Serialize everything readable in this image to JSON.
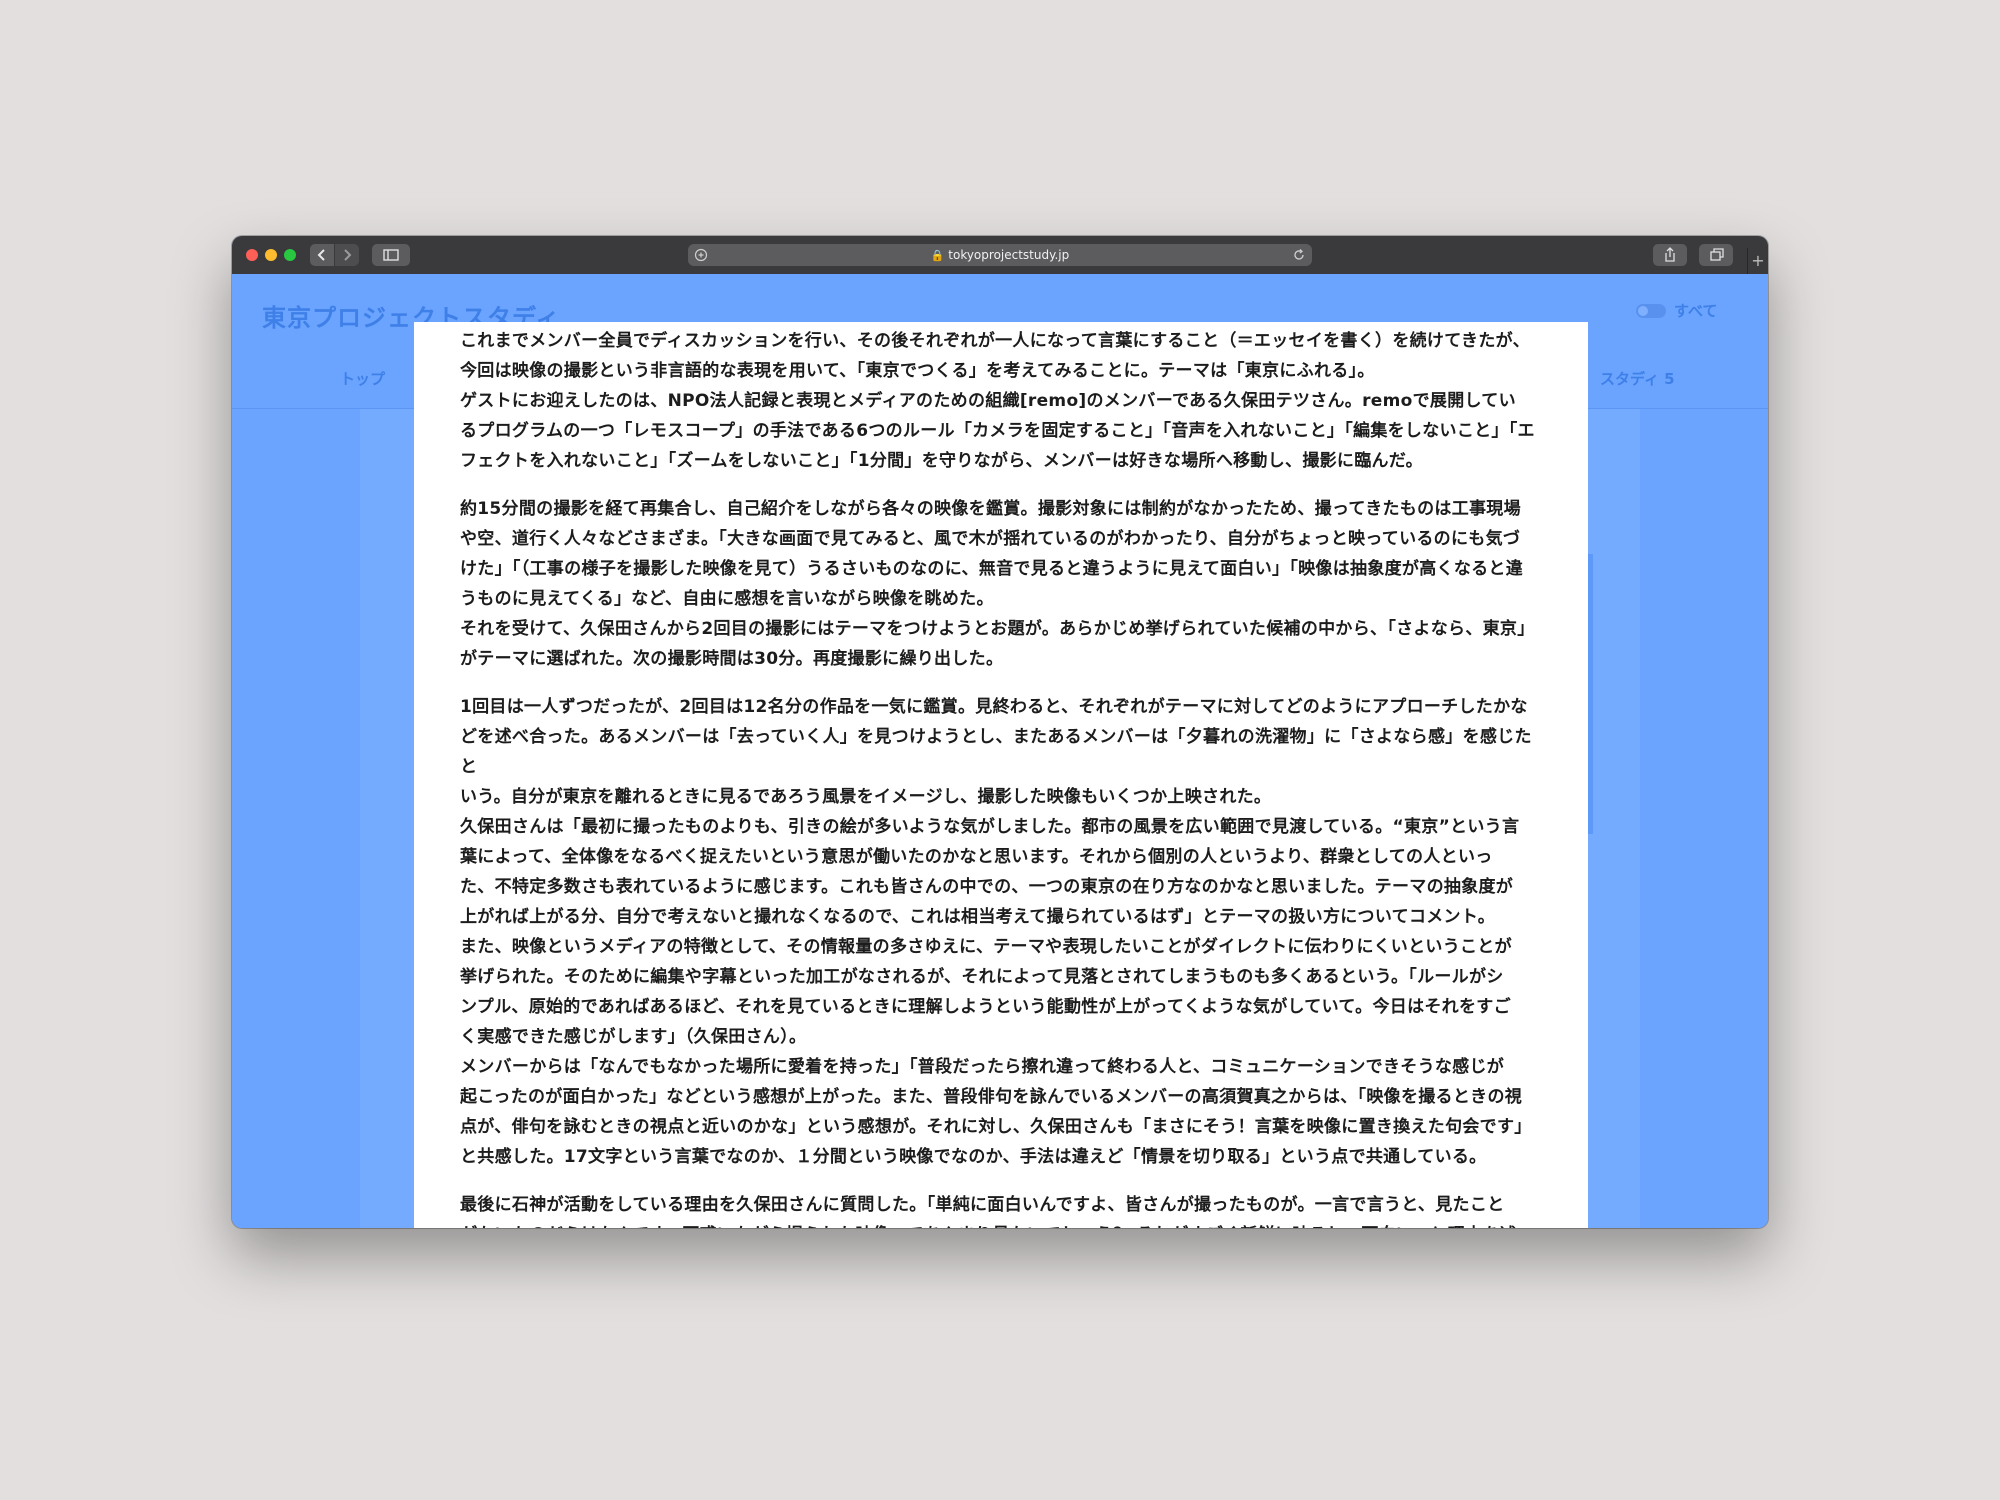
{
  "browser": {
    "url": "tokyoprojectstudy.jp",
    "new_tab_symbol": "+"
  },
  "site": {
    "title": "東京プロジェクトスタディ",
    "nav_top": "トップ",
    "nav_study": "スタディ 5",
    "filter_label": "すべて"
  },
  "article": {
    "paragraphs": [
      "これまでメンバー全員でディスカッションを行い、その後それぞれが一人になって言葉にすること（＝エッセイを書く）を続けてきたが、\n今回は映像の撮影という非言語的な表現を用いて、「東京でつくる」を考えてみることに。テーマは「東京にふれる」。\nゲストにお迎えしたのは、NPO法人記録と表現とメディアのための組織[remo]のメンバーである久保田テツさん。remoで展開してい\nるプログラムの一つ「レモスコープ」の手法である6つのルール「カメラを固定すること」「音声を入れないこと」「編集をしないこと」「エ\nフェクトを入れないこと」「ズームをしないこと」「1分間」を守りながら、メンバーは好きな場所へ移動し、撮影に臨んだ。",
      "約15分間の撮影を経て再集合し、自己紹介をしながら各々の映像を鑑賞。撮影対象には制約がなかったため、撮ってきたものは工事現場\nや空、道行く人々などさまざま。「大きな画面で見てみると、風で木が揺れているのがわかったり、自分がちょっと映っているのにも気づ\nけた」「（工事の様子を撮影した映像を見て）うるさいものなのに、無音で見ると違うように見えて面白い」「映像は抽象度が高くなると違\nうものに見えてくる」など、自由に感想を言いながら映像を眺めた。\nそれを受けて、久保田さんから2回目の撮影にはテーマをつけようとお題が。あらかじめ挙げられていた候補の中から、「さよなら、東京」\nがテーマに選ばれた。次の撮影時間は30分。再度撮影に繰り出した。",
      "1回目は一人ずつだったが、2回目は12名分の作品を一気に鑑賞。見終わると、それぞれがテーマに対してどのようにアプローチしたかな\nどを述べ合った。あるメンバーは「去っていく人」を見つけようとし、またあるメンバーは「夕暮れの洗濯物」に「さよなら感」を感じたと\nいう。自分が東京を離れるときに見るであろう風景をイメージし、撮影した映像もいくつか上映された。\n久保田さんは「最初に撮ったものよりも、引きの絵が多いような気がしました。都市の風景を広い範囲で見渡している。“東京”という言\n葉によって、全体像をなるべく捉えたいという意思が働いたのかなと思います。それから個別の人というより、群衆としての人といっ\nた、不特定多数さも表れているように感じます。これも皆さんの中での、一つの東京の在り方なのかなと思いました。テーマの抽象度が\n上がれば上がる分、自分で考えないと撮れなくなるので、これは相当考えて撮られているはず」とテーマの扱い方についてコメント。\nまた、映像というメディアの特徴として、その情報量の多さゆえに、テーマや表現したいことがダイレクトに伝わりにくいということが\n挙げられた。そのために編集や字幕といった加工がなされるが、それによって見落とされてしまうものも多くあるという。「ルールがシ\nンプル、原始的であればあるほど、それを見ているときに理解しようという能動性が上がってくような気がしていて。今日はそれをすご\nく実感できた感じがします」（久保田さん）。\nメンバーからは「なんでもなかった場所に愛着を持った」「普段だったら擦れ違って終わる人と、コミュニケーションできそうな感じが\n起こったのが面白かった」などという感想が上がった。また、普段俳句を詠んでいるメンバーの高須賀真之からは、「映像を撮るときの視\n点が、俳句を詠むときの視点と近いのかな」という感想が。それに対し、久保田さんも「まさにそう！言葉を映像に置き換えた句会です」\nと共感した。17文字という言葉でなのか、１分間という映像でなのか、手法は違えど「情景を切り取る」という点で共通している。",
      "最後に石神が活動をしている理由を久保田さんに質問した。「単純に面白いんですよ、皆さんが撮ったものが。一言で言うと、見たこと\nがないものだらけなんです。戸惑いながら撮られた映像ってあんまり見ないでしょう？ それがすごく新鮮に映るし、面白い」と理由を述\nべた上で、「同時に、これはコミュニケーションだと思っているんです。そうやって戸惑いながら撮られたものを見せ合うと、やっぱり謎"
    ]
  }
}
